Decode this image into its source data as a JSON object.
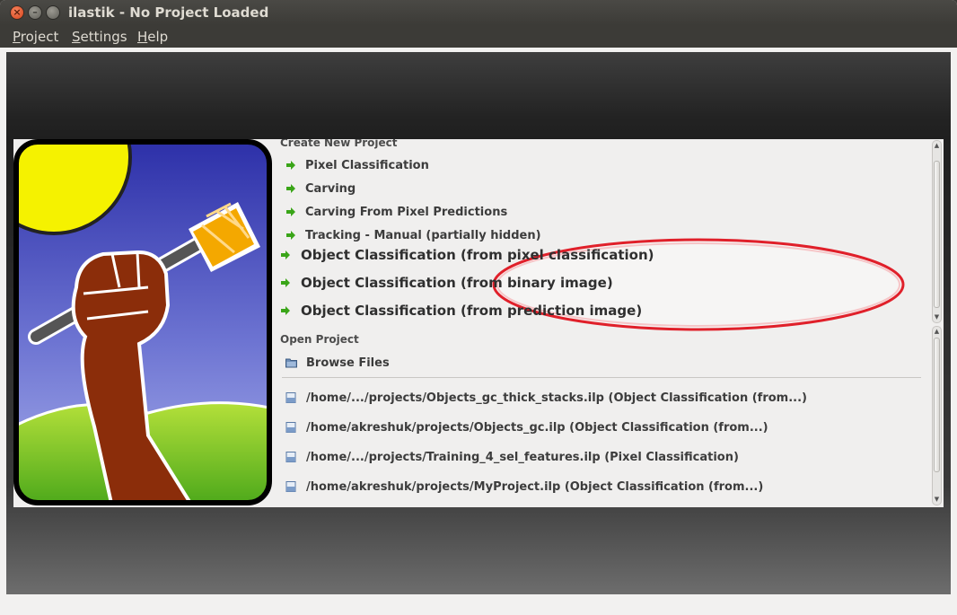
{
  "window": {
    "title": "ilastik - No Project Loaded"
  },
  "menu": {
    "items": [
      "Project",
      "Settings",
      "Help"
    ]
  },
  "create_section": {
    "header": "Create New Project",
    "items": [
      "Pixel Classification",
      "Carving",
      "Carving From Pixel Predictions",
      "Tracking - Manual (partially hidden)"
    ],
    "highlighted_items": [
      "Object Classification (from pixel classification)",
      "Object Classification (from binary image)",
      "Object Classification (from prediction image)"
    ]
  },
  "open_section": {
    "header": "Open Project",
    "browse_label": "Browse Files",
    "recent": [
      "/home/.../projects/Objects_gc_thick_stacks.ilp (Object Classification (from...)",
      "/home/akreshuk/projects/Objects_gc.ilp (Object Classification (from...)",
      "/home/.../projects/Training_4_sel_features.ilp (Pixel Classification)",
      "/home/akreshuk/projects/MyProject.ilp (Object Classification (from...)"
    ]
  },
  "colors": {
    "arrow": "#3aa518",
    "highlight_ring": "#e0202a",
    "title_bar": "#3c3b37"
  }
}
